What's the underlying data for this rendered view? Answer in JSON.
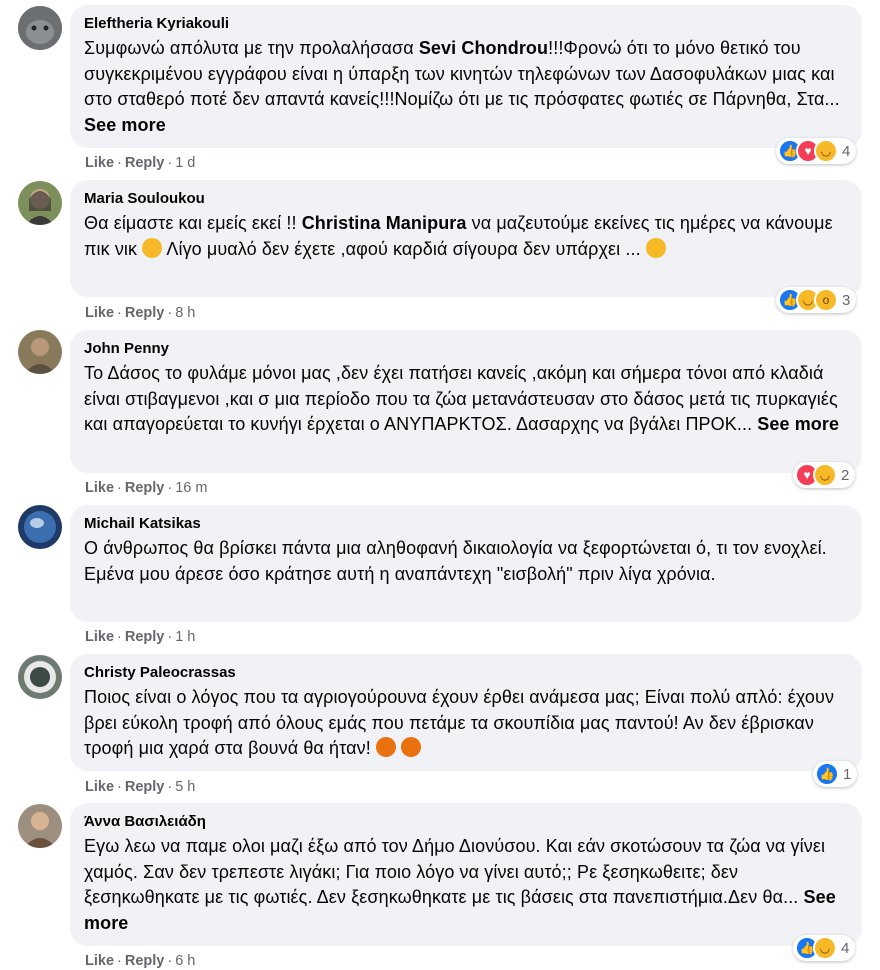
{
  "comments": [
    {
      "author": "Eleftheria Kyriakouli",
      "text_parts": [
        "Συμφωνώ απόλυτα με την προλαλήσασα ",
        "Sevi Chondrou",
        "!!!Φρονώ ότι το μόνο θετικό του συγκεκριμένου εγγράφου είναι η ύπαρξη των κινητών τηλεφώνων των Δασοφυλάκων μιας και στο σταθερό ποτέ δεν απαντά κανείς!!!Νομίζω ότι με τις πρόσφατες φωτιές σε Πάρνηθα, Στα... "
      ],
      "see_more": "See more",
      "like": "Like",
      "reply": "Reply",
      "time": "1 d",
      "reaction_count": "4",
      "avatar_color": "#6b6f72"
    },
    {
      "author": "Maria Souloukou",
      "text_parts": [
        "Θα είμαστε και εμείς εκεί !! ",
        "Christina Manipura",
        " να μαζευτούμε εκείνες τις ημέρες να κάνουμε πικ νικ ",
        "",
        " Λίγο μυαλό δεν έχετε ,αφού καρδιά σίγουρα δεν υπάρχει ... "
      ],
      "like": "Like",
      "reply": "Reply",
      "time": "8 h",
      "reaction_count": "3",
      "avatar_color": "#5f7a4a"
    },
    {
      "author": "John Penny",
      "text_parts": [
        "Το Δάσος το φυλάμε μόνοι μας ,δεν έχει πατήσει κανείς ,ακόμη και σήμερα τόνοι από κλαδιά είναι στιβαγμενοι ,και σ μια περίοδο που τα ζώα μετανάστευσαν στο δάσος μετά τις πυρκαγιές και απαγορεύεται το κυνήγι έρχεται ο ΑΝΥΠΑΡΚΤΟΣ. Δασαρχης να βγάλει ΠΡΟΚ... "
      ],
      "see_more": "See more",
      "like": "Like",
      "reply": "Reply",
      "time": "16 m",
      "reaction_count": "2",
      "avatar_color": "#7a6a4f"
    },
    {
      "author": "Michail Katsikas",
      "text_parts": [
        "Ο άνθρωπος θα βρίσκει πάντα μια αληθοφανή δικαιολογία να ξεφορτώνεται ό, τι τον ενοχλεί. Εμένα μου άρεσε όσο κράτησε αυτή η αναπάντεχη \"εισβολή\" πριν λίγα χρόνια."
      ],
      "like": "Like",
      "reply": "Reply",
      "time": "1 h",
      "reaction_count": "",
      "avatar_color": "#2b4a7a"
    },
    {
      "author": "Christy Paleocrassas",
      "text_parts": [
        "Ποιος είναι ο λόγος που τα αγριογούρουνα έχουν έρθει ανάμεσα μας; Είναι πολύ απλό: έχουν βρει εύκολη τροφή από όλους εμάς που πετάμε τα σκουπίδια μας παντού! Αν δεν έβρισκαν τροφή μια χαρά στα βουνά θα ήταν! "
      ],
      "like": "Like",
      "reply": "Reply",
      "time": "5 h",
      "reaction_count": "1",
      "avatar_color": "#4d5a57"
    },
    {
      "author": "Άννα Βασιλειάδη",
      "text_parts": [
        "Εγω λεω να παμε ολοι μαζι έξω από τον Δήμο Διονύσου. Και εάν σκοτώσουν τα ζώα να γίνει χαμός. Σαν δεν τρεπεστε λιγάκι; Για ποιο λόγο να γίνει αυτό;; Ρε ξεσηκωθειτε; δεν ξεσηκωθηκατε με τις φωτιές. Δεν ξεσηκωθηκατε με τις βάσεις στα πανεπιστήμια.Δεν θα... "
      ],
      "see_more": "See more",
      "like": "Like",
      "reply": "Reply",
      "time": "6 h",
      "reaction_count": "4",
      "avatar_color": "#5a4a40"
    }
  ]
}
